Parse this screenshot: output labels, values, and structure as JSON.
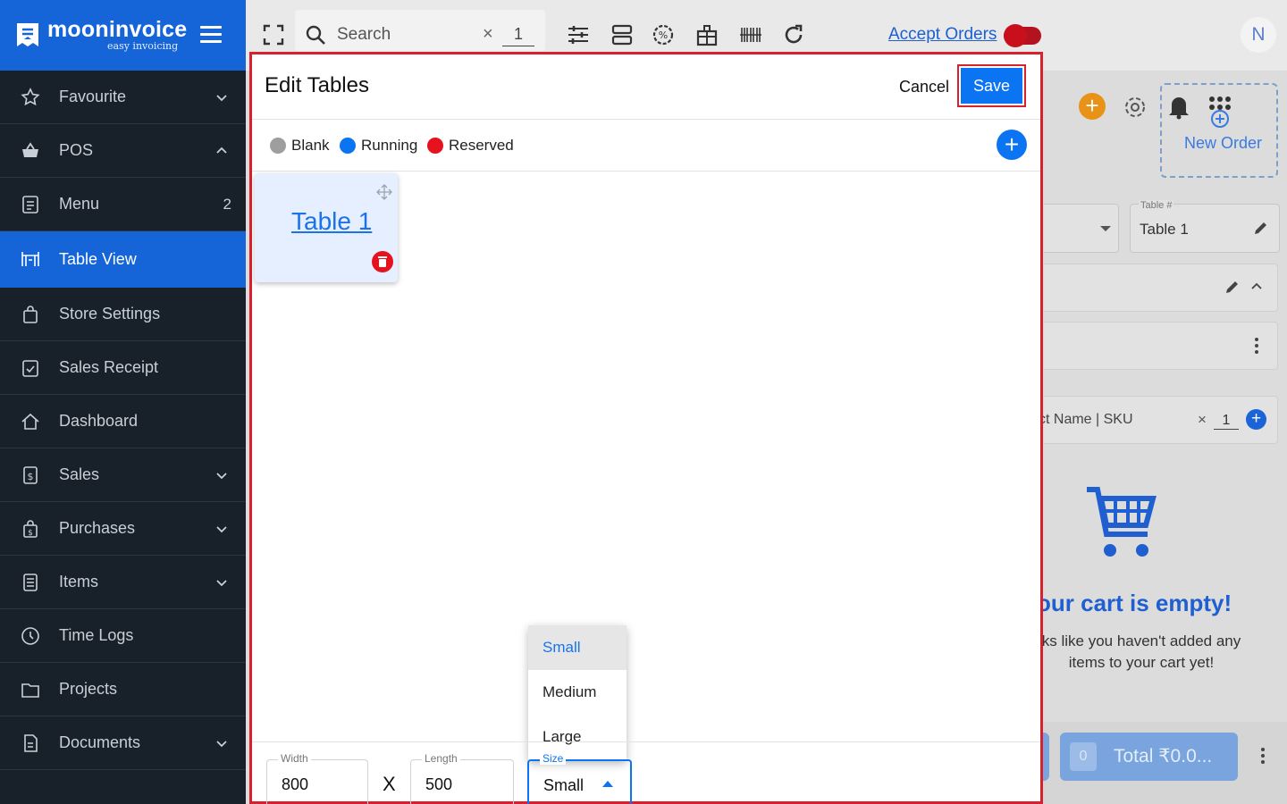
{
  "brand": {
    "name": "mooninvoice",
    "tagline": "easy invoicing"
  },
  "sidebar": {
    "items": [
      {
        "label": "Favourite",
        "icon": "star-icon",
        "chevron": "down"
      },
      {
        "label": "POS",
        "icon": "basket-icon",
        "chevron": "up"
      },
      {
        "label": "Menu",
        "icon": "menu-list-icon",
        "count": "2"
      },
      {
        "label": "Table View",
        "icon": "table-icon",
        "active": true
      },
      {
        "label": "Store Settings",
        "icon": "shopping-bag-icon"
      },
      {
        "label": "Sales Receipt",
        "icon": "receipt-check-icon"
      },
      {
        "label": "Dashboard",
        "icon": "home-icon"
      },
      {
        "label": "Sales",
        "icon": "dollar-doc-icon",
        "chevron": "down"
      },
      {
        "label": "Purchases",
        "icon": "purchase-bag-icon",
        "chevron": "down"
      },
      {
        "label": "Items",
        "icon": "list-doc-icon",
        "chevron": "down"
      },
      {
        "label": "Time Logs",
        "icon": "clock-icon"
      },
      {
        "label": "Projects",
        "icon": "folder-icon"
      },
      {
        "label": "Documents",
        "icon": "document-icon",
        "chevron": "down"
      }
    ]
  },
  "topbar": {
    "search_placeholder": "Search",
    "search_qty": "1",
    "accept_orders": "Accept Orders",
    "avatar_initial": "N"
  },
  "background_panel": {
    "new_order": "New Order",
    "table_field_label": "Table #",
    "table_field_value": "Table 1",
    "product_placeholder": "ct Name | SKU",
    "product_qty": "1",
    "cart_empty_title": "our cart is empty!",
    "cart_empty_message": "ks like you haven't added any items to your cart yet!",
    "total_count": "0",
    "total_label": "Total ₹0.0..."
  },
  "modal": {
    "title": "Edit Tables",
    "cancel_label": "Cancel",
    "save_label": "Save",
    "legend": [
      {
        "label": "Blank",
        "color": "#9e9e9e"
      },
      {
        "label": "Running",
        "color": "#0b74f3"
      },
      {
        "label": "Reserved",
        "color": "#e6121e"
      }
    ],
    "table": {
      "name": "Table 1"
    },
    "footer": {
      "width_label": "Width",
      "width_value": "800",
      "separator": "X",
      "length_label": "Length",
      "length_value": "500",
      "size_label": "Size",
      "size_value": "Small",
      "size_options": [
        "Small",
        "Medium",
        "Large"
      ]
    }
  },
  "colors": {
    "brand_blue": "#1565d8",
    "sidebar_bg": "#182029",
    "primary": "#0b74f3",
    "danger": "#e6121e",
    "highlight_border": "#d9212e"
  }
}
